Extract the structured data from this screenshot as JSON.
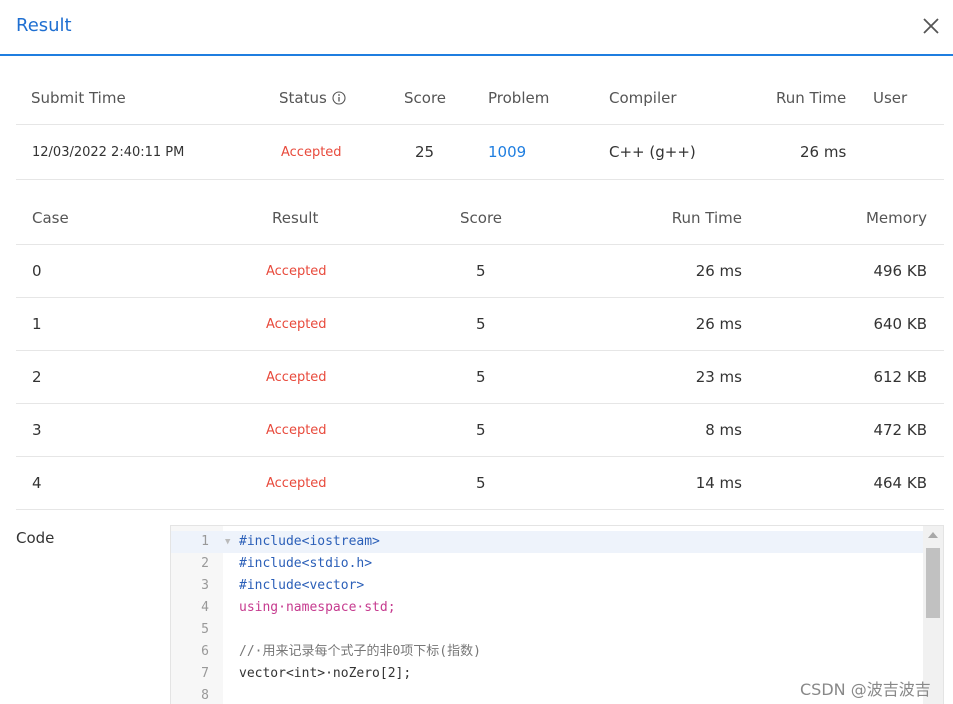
{
  "dialog": {
    "title": "Result",
    "close_icon": "close-icon"
  },
  "submission": {
    "headers": {
      "submit_time": "Submit Time",
      "status": "Status",
      "score": "Score",
      "problem": "Problem",
      "compiler": "Compiler",
      "run_time": "Run Time",
      "user": "User"
    },
    "row": {
      "submit_time": "12/03/2022 2:40:11 PM",
      "status": "Accepted",
      "score": "25",
      "problem": "1009",
      "compiler": "C++ (g++)",
      "run_time": "26 ms",
      "user": ""
    }
  },
  "cases": {
    "headers": {
      "case": "Case",
      "result": "Result",
      "score": "Score",
      "run_time": "Run Time",
      "memory": "Memory"
    },
    "rows": [
      {
        "case": "0",
        "result": "Accepted",
        "score": "5",
        "run_time": "26 ms",
        "memory": "496 KB"
      },
      {
        "case": "1",
        "result": "Accepted",
        "score": "5",
        "run_time": "26 ms",
        "memory": "640 KB"
      },
      {
        "case": "2",
        "result": "Accepted",
        "score": "5",
        "run_time": "23 ms",
        "memory": "612 KB"
      },
      {
        "case": "3",
        "result": "Accepted",
        "score": "5",
        "run_time": "8 ms",
        "memory": "472 KB"
      },
      {
        "case": "4",
        "result": "Accepted",
        "score": "5",
        "run_time": "14 ms",
        "memory": "464 KB"
      }
    ]
  },
  "code": {
    "label": "Code",
    "lines": [
      {
        "n": "1",
        "text": "#include<iostream>"
      },
      {
        "n": "2",
        "text": "#include<stdio.h>"
      },
      {
        "n": "3",
        "text": "#include<vector>"
      },
      {
        "n": "4",
        "text": "using·namespace·std;"
      },
      {
        "n": "5",
        "text": ""
      },
      {
        "n": "6",
        "text": "//·用来记录每个式子的非0项下标(指数)"
      },
      {
        "n": "7",
        "text": "vector<int>·noZero[2];"
      },
      {
        "n": "8",
        "text": ""
      }
    ]
  },
  "watermark": "CSDN @波吉波吉"
}
